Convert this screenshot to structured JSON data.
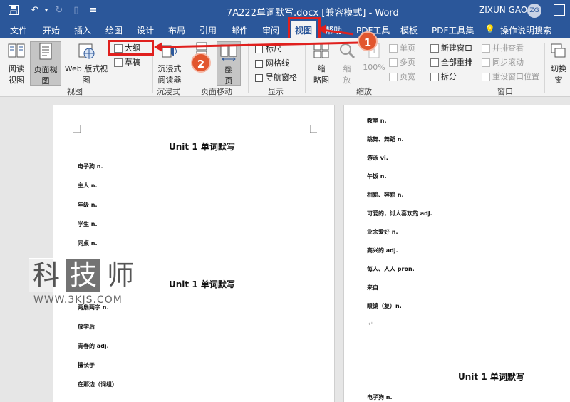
{
  "window": {
    "title": "7A222单词默写.docx [兼容模式] - Word",
    "user": "ZIXUN GAO",
    "avatar": "ZG"
  },
  "quick_access": {
    "save_icon": "save-icon",
    "undo_icon": "undo-icon",
    "redo_icon": "redo-icon",
    "customize_icon": "customize-icon"
  },
  "tabs": [
    "文件",
    "开始",
    "插入",
    "绘图",
    "设计",
    "布局",
    "引用",
    "邮件",
    "审阅",
    "视图",
    "帮助",
    "PDF工具",
    "模板",
    "PDF工具集",
    "操作说明搜索"
  ],
  "active_tab": "视图",
  "ribbon": {
    "views": {
      "read": "阅读\n视图",
      "read_l1": "阅读",
      "read_l2": "视图",
      "print": "页面视图",
      "web": "Web 版式视图",
      "outline": "大纲",
      "draft": "草稿",
      "group": "视图"
    },
    "immersive": {
      "reader_l1": "沉浸式",
      "reader_l2": "阅读器",
      "group": "沉浸式"
    },
    "page_move": {
      "vertical": "直",
      "side_l1": "翻",
      "side_l2": "页",
      "group": "页面移动"
    },
    "show": {
      "ruler": "标尺",
      "gridlines": "网格线",
      "nav_pane": "导航窗格",
      "group": "显示"
    },
    "zoom": {
      "onepage_l1": "缩",
      "onepage_l2": "略图",
      "zoom_l1": "缩",
      "zoom_l2": "放",
      "hundred": "100%",
      "single": "单页",
      "multi": "多页",
      "width": "页宽",
      "group": "缩放"
    },
    "window": {
      "new_window": "新建窗口",
      "arrange_all": "全部重排",
      "split": "拆分",
      "side_by_side": "并排查看",
      "sync_scroll": "同步滚动",
      "reset_pos": "重设窗口位置",
      "switch": "切换窗",
      "group": "窗口"
    }
  },
  "annotations": {
    "step1": "1",
    "step2": "2"
  },
  "document": {
    "page1": {
      "heading1": "Unit 1 单词默写",
      "items1": [
        "电子狗 n.",
        "主人 n.",
        "年级 n.",
        "学生 n.",
        "同桌 n."
      ],
      "heading2": "Unit 1 单词默写",
      "items2": [
        "两扇两字 n.",
        "放学后",
        "青春的 adj.",
        "擅长于",
        "在那边（词组）"
      ]
    },
    "page2": {
      "items": [
        "教室 n.",
        "跳舞、舞蹈 n.",
        "游泳 vi.",
        "午饭 n.",
        "相貌、容貌 n.",
        "可爱的，讨人喜欢的 adj.",
        "业余爱好 n.",
        "高兴的 adj.",
        "每人、人人 pron.",
        "来自",
        "眼镜（复）n."
      ],
      "heading": "Unit 1 单词默写",
      "items_after": [
        "电子狗 n."
      ]
    }
  },
  "watermark": {
    "c1": "科",
    "c2": "技",
    "c3": "师",
    "url": "WWW.3KJS.COM"
  },
  "colors": {
    "accent": "#2b579a",
    "highlight": "#e0201e",
    "badge": "#e2562e"
  }
}
